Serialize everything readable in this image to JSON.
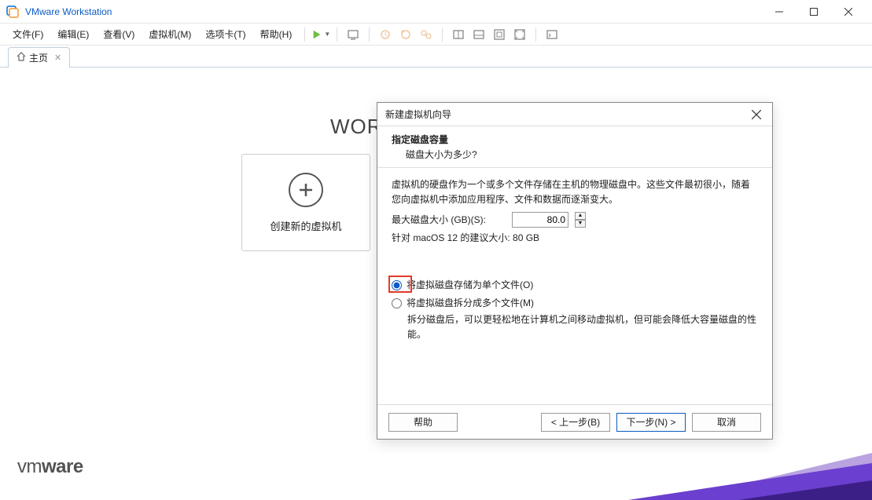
{
  "window": {
    "title": "VMware Workstation"
  },
  "menus": {
    "file": "文件(F)",
    "edit": "编辑(E)",
    "view": "查看(V)",
    "vm": "虚拟机(M)",
    "tabs": "选项卡(T)",
    "help": "帮助(H)"
  },
  "tab": {
    "label": "主页"
  },
  "home": {
    "brand_word": "WORK",
    "tile_label": "创建新的虚拟机",
    "logo_prefix": "vm",
    "logo_suffix": "ware"
  },
  "dialog": {
    "title": "新建虚拟机向导",
    "header_title": "指定磁盘容量",
    "header_sub": "磁盘大小为多少?",
    "intro": "虚拟机的硬盘作为一个或多个文件存储在主机的物理磁盘中。这些文件最初很小，随着您向虚拟机中添加应用程序、文件和数据而逐渐变大。",
    "size_label": "最大磁盘大小 (GB)(S):",
    "size_value": "80.0",
    "recommend": "针对 macOS 12 的建议大小: 80 GB",
    "opt_single": "将虚拟磁盘存储为单个文件(O)",
    "opt_split": "将虚拟磁盘拆分成多个文件(M)",
    "split_help": "拆分磁盘后，可以更轻松地在计算机之间移动虚拟机，但可能会降低大容量磁盘的性能。",
    "buttons": {
      "help": "帮助",
      "back": "< 上一步(B)",
      "next": "下一步(N) >",
      "cancel": "取消"
    }
  }
}
